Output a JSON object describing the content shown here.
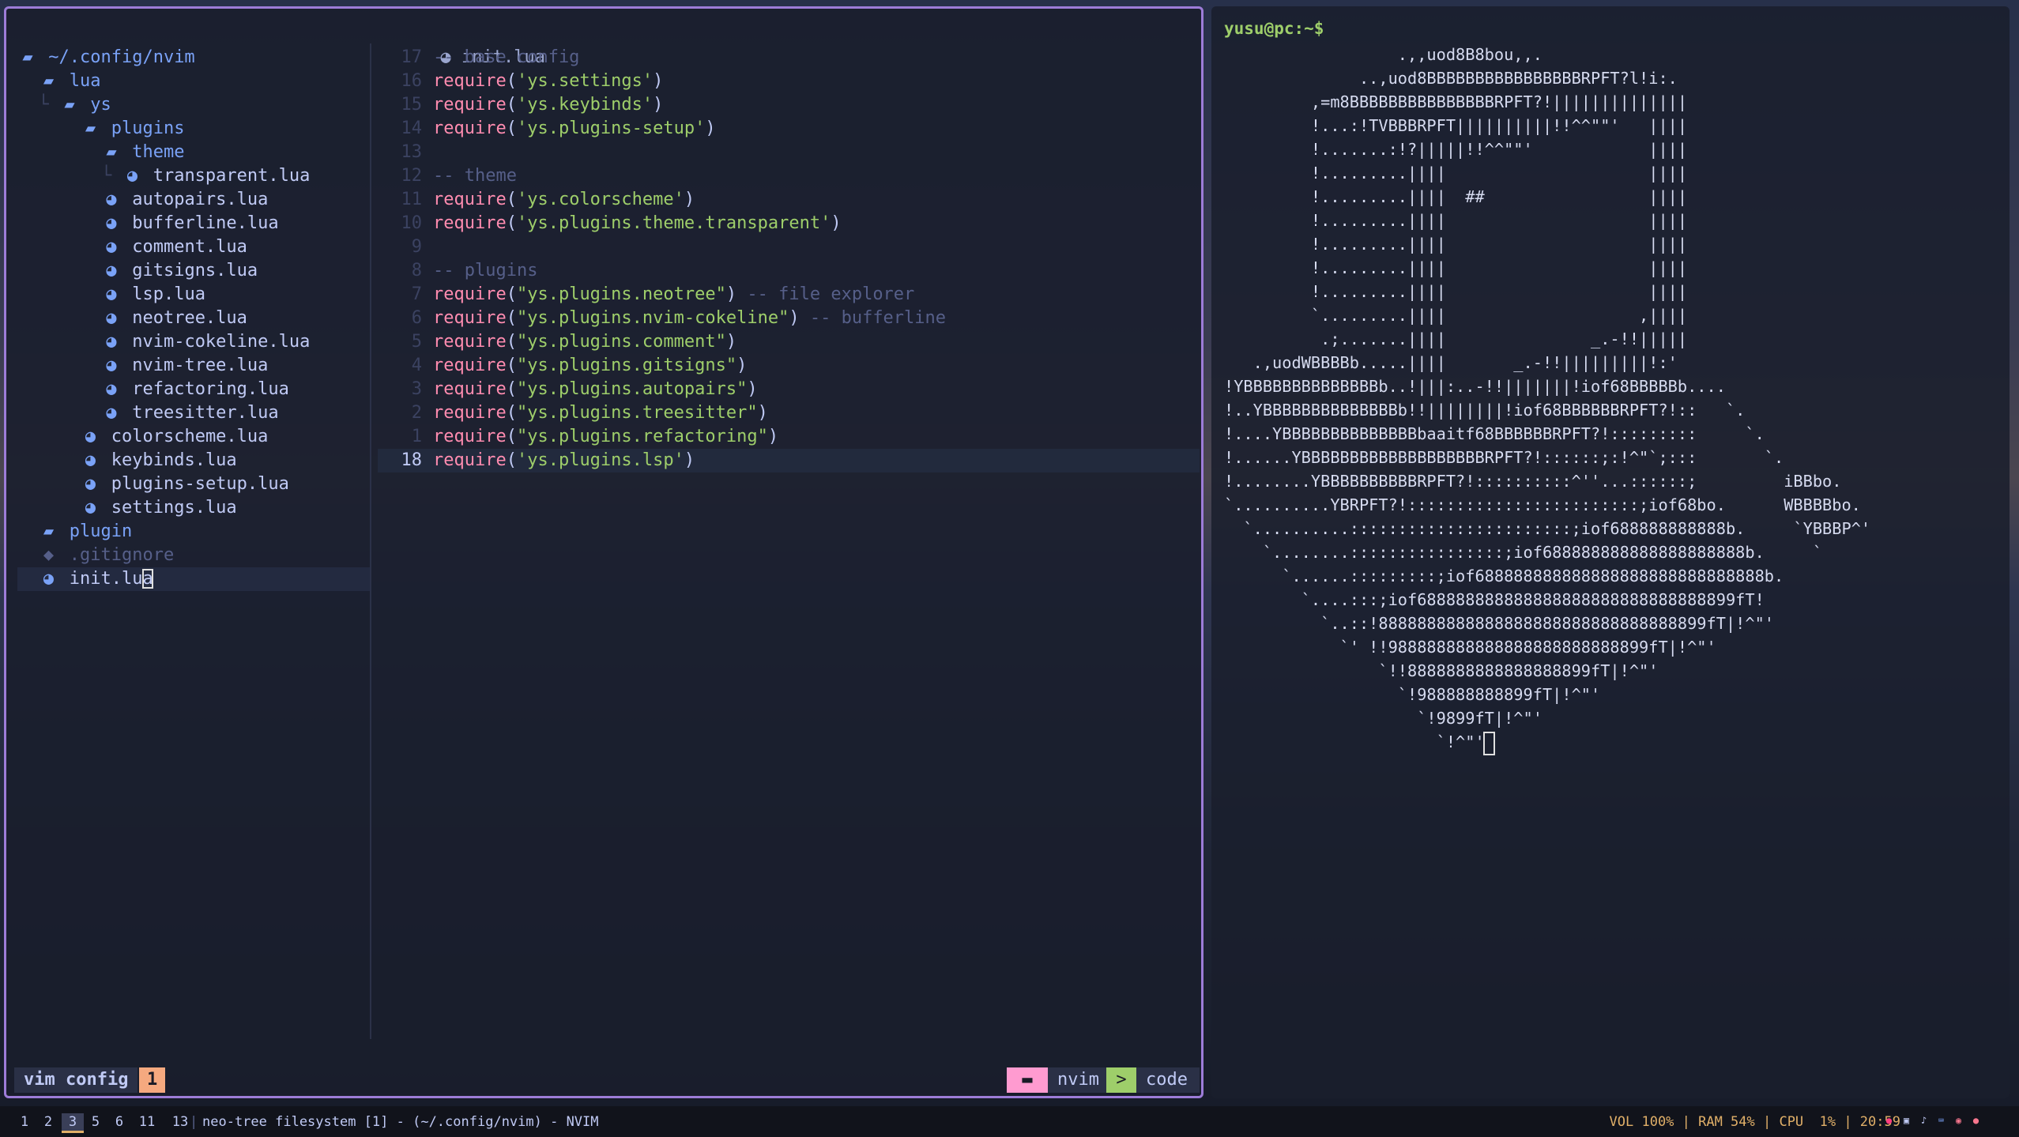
{
  "nvim": {
    "tree": [
      {
        "indent": "",
        "type": "dir",
        "name": "~/.config/nvim",
        "icon": "folder-open-icon"
      },
      {
        "indent": "  ",
        "type": "dir",
        "name": "lua",
        "icon": "folder-open-icon"
      },
      {
        "indent": "  └ ",
        "type": "dir",
        "name": "ys",
        "icon": "folder-open-icon"
      },
      {
        "indent": "      ",
        "type": "dir",
        "name": "plugins",
        "icon": "folder-open-icon"
      },
      {
        "indent": "        ",
        "type": "dir",
        "name": "theme",
        "icon": "folder-open-icon"
      },
      {
        "indent": "        └ ",
        "type": "file",
        "name": "transparent.lua",
        "icon": "lua-icon"
      },
      {
        "indent": "        ",
        "type": "file",
        "name": "autopairs.lua",
        "icon": "lua-icon"
      },
      {
        "indent": "        ",
        "type": "file",
        "name": "bufferline.lua",
        "icon": "lua-icon"
      },
      {
        "indent": "        ",
        "type": "file",
        "name": "comment.lua",
        "icon": "lua-icon"
      },
      {
        "indent": "        ",
        "type": "file",
        "name": "gitsigns.lua",
        "icon": "lua-icon"
      },
      {
        "indent": "        ",
        "type": "file",
        "name": "lsp.lua",
        "icon": "lua-icon"
      },
      {
        "indent": "        ",
        "type": "file",
        "name": "neotree.lua",
        "icon": "lua-icon"
      },
      {
        "indent": "        ",
        "type": "file",
        "name": "nvim-cokeline.lua",
        "icon": "lua-icon"
      },
      {
        "indent": "        ",
        "type": "file",
        "name": "nvim-tree.lua",
        "icon": "lua-icon"
      },
      {
        "indent": "        ",
        "type": "file",
        "name": "refactoring.lua",
        "icon": "lua-icon"
      },
      {
        "indent": "        ",
        "type": "file",
        "name": "treesitter.lua",
        "icon": "lua-icon"
      },
      {
        "indent": "      ",
        "type": "file",
        "name": "colorscheme.lua",
        "icon": "lua-icon"
      },
      {
        "indent": "      ",
        "type": "file",
        "name": "keybinds.lua",
        "icon": "lua-icon"
      },
      {
        "indent": "      ",
        "type": "file",
        "name": "plugins-setup.lua",
        "icon": "lua-icon"
      },
      {
        "indent": "      ",
        "type": "file",
        "name": "settings.lua",
        "icon": "lua-icon"
      },
      {
        "indent": "  ",
        "type": "dir",
        "name": "plugin",
        "icon": "folder-closed-icon"
      },
      {
        "indent": "  ",
        "type": "dim",
        "name": ".gitignore",
        "icon": "git-icon"
      },
      {
        "indent": "  ",
        "type": "file",
        "name": "init.lua",
        "icon": "lua-icon",
        "selected": true
      }
    ],
    "editor_title": "init.lua",
    "code": [
      {
        "ln": "17",
        "parts": [
          [
            "cmt",
            "-- base config"
          ]
        ]
      },
      {
        "ln": "16",
        "parts": [
          [
            "kw",
            "require"
          ],
          [
            "plain",
            "("
          ],
          [
            "str",
            "'ys.settings'"
          ],
          [
            "plain",
            ")"
          ]
        ]
      },
      {
        "ln": "15",
        "parts": [
          [
            "kw",
            "require"
          ],
          [
            "plain",
            "("
          ],
          [
            "str",
            "'ys.keybinds'"
          ],
          [
            "plain",
            ")"
          ]
        ]
      },
      {
        "ln": "14",
        "parts": [
          [
            "kw",
            "require"
          ],
          [
            "plain",
            "("
          ],
          [
            "str",
            "'ys.plugins-setup'"
          ],
          [
            "plain",
            ")"
          ]
        ]
      },
      {
        "ln": "13",
        "parts": []
      },
      {
        "ln": "12",
        "parts": [
          [
            "cmt",
            "-- theme"
          ]
        ]
      },
      {
        "ln": "11",
        "parts": [
          [
            "kw",
            "require"
          ],
          [
            "plain",
            "("
          ],
          [
            "str",
            "'ys.colorscheme'"
          ],
          [
            "plain",
            ")"
          ]
        ]
      },
      {
        "ln": "10",
        "parts": [
          [
            "kw",
            "require"
          ],
          [
            "plain",
            "("
          ],
          [
            "str",
            "'ys.plugins.theme.transparent'"
          ],
          [
            "plain",
            ")"
          ]
        ]
      },
      {
        "ln": "9",
        "parts": []
      },
      {
        "ln": "8",
        "parts": [
          [
            "cmt",
            "-- plugins"
          ]
        ]
      },
      {
        "ln": "7",
        "parts": [
          [
            "kw",
            "require"
          ],
          [
            "plain",
            "("
          ],
          [
            "str",
            "\"ys.plugins.neotree\""
          ],
          [
            "plain",
            ") "
          ],
          [
            "cmt",
            "-- file explorer"
          ]
        ]
      },
      {
        "ln": "6",
        "parts": [
          [
            "kw",
            "require"
          ],
          [
            "plain",
            "("
          ],
          [
            "str",
            "\"ys.plugins.nvim-cokeline\""
          ],
          [
            "plain",
            ") "
          ],
          [
            "cmt",
            "-- bufferline"
          ]
        ]
      },
      {
        "ln": "5",
        "parts": [
          [
            "kw",
            "require"
          ],
          [
            "plain",
            "("
          ],
          [
            "str",
            "\"ys.plugins.comment\""
          ],
          [
            "plain",
            ")"
          ]
        ]
      },
      {
        "ln": "4",
        "parts": [
          [
            "kw",
            "require"
          ],
          [
            "plain",
            "("
          ],
          [
            "str",
            "\"ys.plugins.gitsigns\""
          ],
          [
            "plain",
            ")"
          ]
        ]
      },
      {
        "ln": "3",
        "parts": [
          [
            "kw",
            "require"
          ],
          [
            "plain",
            "("
          ],
          [
            "str",
            "\"ys.plugins.autopairs\""
          ],
          [
            "plain",
            ")"
          ]
        ]
      },
      {
        "ln": "2",
        "parts": [
          [
            "kw",
            "require"
          ],
          [
            "plain",
            "("
          ],
          [
            "str",
            "\"ys.plugins.treesitter\""
          ],
          [
            "plain",
            ")"
          ]
        ]
      },
      {
        "ln": "1",
        "parts": [
          [
            "kw",
            "require"
          ],
          [
            "plain",
            "("
          ],
          [
            "str",
            "\"ys.plugins.refactoring\""
          ],
          [
            "plain",
            ")"
          ]
        ]
      },
      {
        "ln": "18",
        "current": true,
        "parts": [
          [
            "kw",
            "require"
          ],
          [
            "plain",
            "("
          ],
          [
            "str",
            "'ys.plugins.lsp'"
          ],
          [
            "plain",
            ")"
          ]
        ]
      }
    ],
    "status": {
      "mode": "vim config",
      "number": "1",
      "folder_icon": "folder-icon",
      "cwd": "nvim",
      "term_icon": "terminal-icon",
      "type": "code"
    }
  },
  "terminal": {
    "prompt": "yusu@pc:~$",
    "art": [
      "                  .,,uod8B8bou,,.",
      "              ..,uod8BBBBBBBBBBBBBBBBRPFT?l!i:.",
      "         ,=m8BBBBBBBBBBBBBBBRPFT?!||||||||||||||",
      "         !...:!TVBBBRPFT||||||||||!!^^\"\"'   ||||",
      "         !.......:!?|||||!!^^\"\"'            ||||",
      "         !.........||||                     ||||",
      "         !.........||||  ##                 ||||",
      "         !.........||||                     ||||",
      "         !.........||||                     ||||",
      "         !.........||||                     ||||",
      "         !.........||||                     ||||",
      "         `.........||||                    ,||||",
      "          .;.......||||               _.-!!|||||",
      "   .,uodWBBBBb.....||||       _.-!!|||||||||!:'",
      "!YBBBBBBBBBBBBBBb..!|||:..-!!|||||||!iof68BBBBBb....",
      "!..YBBBBBBBBBBBBBBb!!||||||||!iof68BBBBBBRPFT?!::   `.",
      "!....YBBBBBBBBBBBBBBbaaitf68BBBBBBRPFT?!:::::::::     `.",
      "!......YBBBBBBBBBBBBBBBBBBBRPFT?!::::::;:!^\"`;:::       `.",
      "!........YBBBBBBBBBBRPFT?!::::::::::^''...::::::;         iBBbo.",
      "`..........YBRPFT?!::::::::::::::::::::::::;iof68bo.      WBBBBbo.",
      "  `..........:::::::::::::::::::::::;iof688888888888b.     `YBBBP^'",
      "    `........::::::::::::::::;iof688888888888888888888b.     `",
      "      `......:::::::::;iof688888888888888888888888888888b.",
      "        `....:::;iof688888888888888888888888888888899fT!",
      "          `..::!8888888888888888888888888888888899fT|!^\"'",
      "            `' !!988888888888888888888888899fT|!^\"'",
      "                `!!8888888888888888899fT|!^\"'",
      "                  `!988888888899fT|!^\"'",
      "                    `!9899fT|!^\"'",
      "                      `!^\"'"
    ]
  },
  "bar": {
    "workspaces": [
      "1",
      "2",
      "3",
      "5",
      "6",
      "11",
      "13"
    ],
    "active_workspace": "3",
    "separator": "|",
    "title": "neo-tree filesystem [1] - (~/.config/nvim) - NVIM",
    "status": "VOL 100% | RAM 54% | CPU  1% | 20:59",
    "tray_icons": [
      "tray-app-icon",
      "tray-window-icon",
      "tray-music-icon",
      "tray-keyboard-icon",
      "tray-chat-icon",
      "tray-record-icon"
    ]
  }
}
